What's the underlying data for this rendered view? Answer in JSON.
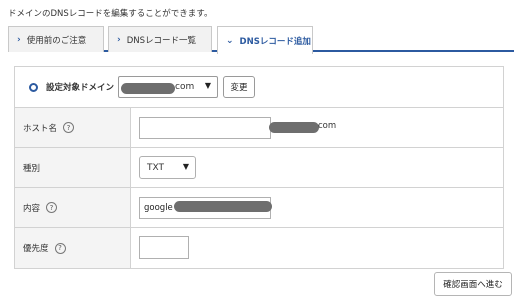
{
  "intro_text": "ドメインのDNSレコードを編集することができます。",
  "tabs": [
    {
      "label": "使用前のご注意",
      "icon": "chevron-right-icon",
      "active": false
    },
    {
      "label": "DNSレコード一覧",
      "icon": "chevron-right-icon",
      "active": false
    },
    {
      "label": "DNSレコード追加",
      "icon": "chevron-down-icon",
      "active": true
    }
  ],
  "domain": {
    "label": "設定対象ドメイン",
    "selected_suffix": "com",
    "change_button": "変更"
  },
  "form": {
    "host": {
      "label": "ホスト名",
      "value": "",
      "suffix": "com"
    },
    "type": {
      "label": "種別",
      "selected": "TXT"
    },
    "content": {
      "label": "内容",
      "value": "google"
    },
    "priority": {
      "label": "優先度",
      "value": ""
    }
  },
  "confirm_button": "確認画面へ進む",
  "colors": {
    "accent": "#2c5aa0",
    "label_bg": "#f4f4f4",
    "border": "#d2d2d2"
  }
}
